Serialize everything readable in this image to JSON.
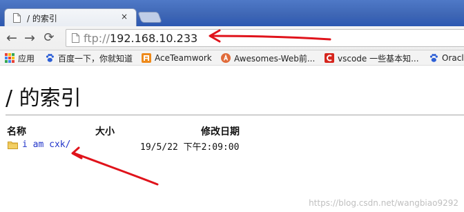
{
  "window": {
    "tab_title": "/ 的索引",
    "tab_close": "×"
  },
  "toolbar": {
    "back_glyph": "←",
    "forward_glyph": "→",
    "reload_glyph": "⟳",
    "url_scheme": "ftp://",
    "url_host": "192.168.10.233"
  },
  "bookmarks": [
    {
      "label": "应用",
      "icon": "apps-grid-icon"
    },
    {
      "label": "百度一下，你就知道",
      "icon": "baidu-paw-icon"
    },
    {
      "label": "AceTeamwork",
      "icon": "aceteamwork-icon"
    },
    {
      "label": "Awesomes-Web前...",
      "icon": "awesomes-icon"
    },
    {
      "label": "vscode 一些基本知...",
      "icon": "csdn-icon"
    },
    {
      "label": "Oracl",
      "icon": "baidu-paw-icon"
    }
  ],
  "page": {
    "heading": "/ 的索引",
    "columns": {
      "name": "名称",
      "size": "大小",
      "modified": "修改日期"
    },
    "rows": [
      {
        "name": "i am cxk/",
        "size": "",
        "modified": "19/5/22 下午2:09:00",
        "icon": "folder-icon"
      }
    ]
  },
  "watermark": "https://blog.csdn.net/wangbiao9292",
  "colors": {
    "annotation_arrow": "#e0131b",
    "link": "#1f33c9",
    "titlebar": "#3f67b5"
  }
}
